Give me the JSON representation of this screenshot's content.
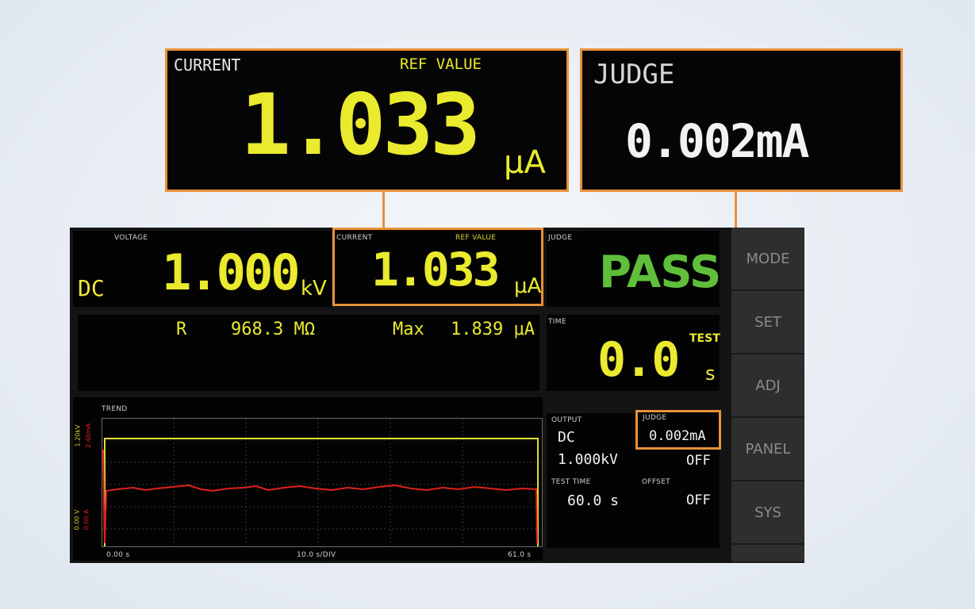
{
  "callout_current": {
    "label": "CURRENT",
    "ref_label": "REF VALUE",
    "value": "1.033",
    "unit": "μA"
  },
  "callout_judge": {
    "label": "JUDGE",
    "value": "0.002mA"
  },
  "voltage": {
    "label": "VOLTAGE",
    "mode": "DC",
    "value": "1.000",
    "unit": "kV"
  },
  "current": {
    "label": "CURRENT",
    "ref_label": "REF VALUE",
    "value": "1.033",
    "unit": "μA"
  },
  "judge": {
    "label": "JUDGE",
    "result": "PASS"
  },
  "resistance": {
    "label": "R",
    "value": "968.3 MΩ",
    "max_label": "Max",
    "max_value": "1.839 μA"
  },
  "time": {
    "label": "TIME",
    "test_label": "TEST",
    "value": "0.0",
    "unit": "s"
  },
  "trend": {
    "label": "TREND",
    "y_left_top": "1.20kV",
    "y_left_bottom": "0.00 V",
    "y_right_top": "2.40mA",
    "y_right_bottom": "0.00 A",
    "x_start": "0.00 s",
    "x_div": "10.0 s/DIV",
    "x_end": "61.0 s",
    "voltage_color": "#dede34",
    "current_color": "#e0201c"
  },
  "output_panel": {
    "output_label": "OUTPUT",
    "output_mode": "DC",
    "output_value": "1.000kV",
    "judge_label": "JUDGE",
    "judge_value": "0.002mA",
    "judge_state": "OFF",
    "test_time_label": "TEST TIME",
    "test_time_value": "60.0 s",
    "offset_label": "OFFSET",
    "offset_state": "OFF"
  },
  "side_menu": [
    "MODE",
    "SET",
    "ADJ",
    "PANEL",
    "SYS"
  ],
  "colors": {
    "accent": "#e8913a",
    "pass": "#5fbf3a",
    "lcd_yellow": "#eaea2e"
  }
}
